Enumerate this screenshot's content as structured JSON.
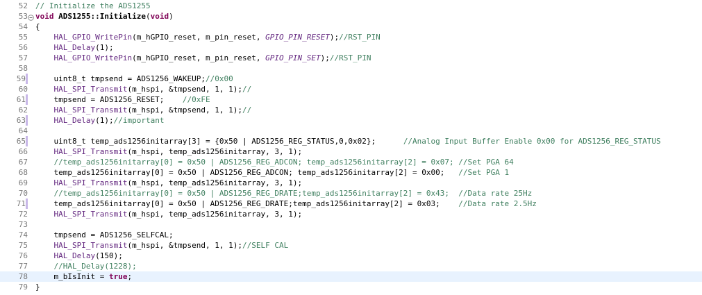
{
  "editor": {
    "lines": [
      {
        "num": "52",
        "tokens": [
          {
            "t": "// Initialize the ADS1255",
            "c": "cmt"
          }
        ]
      },
      {
        "num": "53",
        "fold": true,
        "tokens": [
          {
            "t": "void ",
            "c": "kw"
          },
          {
            "t": "ADS1255::Initialize",
            "c": "fn"
          },
          {
            "t": "(",
            "c": "plain"
          },
          {
            "t": "void",
            "c": "kw"
          },
          {
            "t": ")",
            "c": "plain"
          }
        ]
      },
      {
        "num": "54",
        "tokens": [
          {
            "t": "{",
            "c": "plain"
          }
        ]
      },
      {
        "num": "55",
        "tokens": [
          {
            "t": "    HAL_GPIO_WritePin",
            "c": "fnp"
          },
          {
            "t": "(m_hGPIO_reset, m_pin_reset, ",
            "c": "plain"
          },
          {
            "t": "GPIO_PIN_RESET",
            "c": "macro"
          },
          {
            "t": ");",
            "c": "plain"
          },
          {
            "t": "//RST_PIN",
            "c": "cmt"
          }
        ]
      },
      {
        "num": "56",
        "tokens": [
          {
            "t": "    HAL_Delay",
            "c": "fnp"
          },
          {
            "t": "(1);",
            "c": "plain"
          }
        ]
      },
      {
        "num": "57",
        "tokens": [
          {
            "t": "    HAL_GPIO_WritePin",
            "c": "fnp"
          },
          {
            "t": "(m_hGPIO_reset, m_pin_reset, ",
            "c": "plain"
          },
          {
            "t": "GPIO_PIN_SET",
            "c": "macro"
          },
          {
            "t": ");",
            "c": "plain"
          },
          {
            "t": "//RST_PIN",
            "c": "cmt"
          }
        ]
      },
      {
        "num": "58",
        "tokens": []
      },
      {
        "num": "59",
        "changed": true,
        "tokens": [
          {
            "t": "    uint8_t tmpsend = ADS1256_WAKEUP;",
            "c": "plain"
          },
          {
            "t": "//0x00",
            "c": "cmt"
          }
        ]
      },
      {
        "num": "60",
        "tokens": [
          {
            "t": "    HAL_SPI_Transmit",
            "c": "fnp"
          },
          {
            "t": "(m_hspi, &tmpsend, 1, 1);",
            "c": "plain"
          },
          {
            "t": "//",
            "c": "cmt"
          }
        ]
      },
      {
        "num": "61",
        "changed": true,
        "tokens": [
          {
            "t": "    tmpsend = ADS1256_RESET;    ",
            "c": "plain"
          },
          {
            "t": "//0xFE",
            "c": "cmt"
          }
        ]
      },
      {
        "num": "62",
        "tokens": [
          {
            "t": "    HAL_SPI_Transmit",
            "c": "fnp"
          },
          {
            "t": "(m_hspi, &tmpsend, 1, 1);",
            "c": "plain"
          },
          {
            "t": "//",
            "c": "cmt"
          }
        ]
      },
      {
        "num": "63",
        "changed": true,
        "tokens": [
          {
            "t": "    HAL_Delay",
            "c": "fnp"
          },
          {
            "t": "(1);",
            "c": "plain"
          },
          {
            "t": "//important",
            "c": "cmt"
          }
        ]
      },
      {
        "num": "64",
        "tokens": []
      },
      {
        "num": "65",
        "changed": true,
        "tokens": [
          {
            "t": "    uint8_t temp_ads1256initarray[3] = {0x50 | ADS1256_REG_STATUS,0,0x02};      ",
            "c": "plain"
          },
          {
            "t": "//Analog Input Buffer Enable 0x00 for ADS1256_REG_STATUS",
            "c": "cmt"
          }
        ]
      },
      {
        "num": "66",
        "tokens": [
          {
            "t": "    HAL_SPI_Transmit",
            "c": "fnp"
          },
          {
            "t": "(m_hspi, temp_ads1256initarray, 3, 1);",
            "c": "plain"
          }
        ]
      },
      {
        "num": "67",
        "tokens": [
          {
            "t": "    //temp_ads1256initarray[0] = 0x50 | ADS1256_REG_ADCON; temp_ads1256initarray[2] = 0x07; //Set PGA 64",
            "c": "cmt"
          }
        ]
      },
      {
        "num": "68",
        "tokens": [
          {
            "t": "    temp_ads1256initarray[0] = 0x50 | ADS1256_REG_ADCON; temp_ads1256initarray[2] = 0x00;   ",
            "c": "plain"
          },
          {
            "t": "//Set PGA 1",
            "c": "cmt"
          }
        ]
      },
      {
        "num": "69",
        "tokens": [
          {
            "t": "    HAL_SPI_Transmit",
            "c": "fnp"
          },
          {
            "t": "(m_hspi, temp_ads1256initarray, 3, 1);",
            "c": "plain"
          }
        ]
      },
      {
        "num": "70",
        "tokens": [
          {
            "t": "    //temp_ads1256initarray[0] = 0x50 | ADS1256_REG_DRATE;temp_ads1256initarray[2] = 0x43;  //Data rate 25Hz",
            "c": "cmt"
          }
        ]
      },
      {
        "num": "71",
        "changed": true,
        "tokens": [
          {
            "t": "    temp_ads1256initarray[0] = 0x50 | ADS1256_REG_DRATE;temp_ads1256initarray[2] = 0x03;    ",
            "c": "plain"
          },
          {
            "t": "//Data rate 2.5Hz",
            "c": "cmt"
          }
        ]
      },
      {
        "num": "72",
        "tokens": [
          {
            "t": "    HAL_SPI_Transmit",
            "c": "fnp"
          },
          {
            "t": "(m_hspi, temp_ads1256initarray, 3, 1);",
            "c": "plain"
          }
        ]
      },
      {
        "num": "73",
        "tokens": []
      },
      {
        "num": "74",
        "tokens": [
          {
            "t": "    tmpsend = ADS1256_SELFCAL;",
            "c": "plain"
          }
        ]
      },
      {
        "num": "75",
        "tokens": [
          {
            "t": "    HAL_SPI_Transmit",
            "c": "fnp"
          },
          {
            "t": "(m_hspi, &tmpsend, 1, 1);",
            "c": "plain"
          },
          {
            "t": "//SELF CAL",
            "c": "cmt"
          }
        ]
      },
      {
        "num": "76",
        "tokens": [
          {
            "t": "    HAL_Delay",
            "c": "fnp"
          },
          {
            "t": "(150);",
            "c": "plain"
          }
        ]
      },
      {
        "num": "77",
        "tokens": [
          {
            "t": "    //HAL_Delay(1228);",
            "c": "cmt"
          }
        ]
      },
      {
        "num": "78",
        "current": true,
        "tokens": [
          {
            "t": "    m_bIsInit = ",
            "c": "plain"
          },
          {
            "t": "true",
            "c": "kw"
          },
          {
            "t": ";",
            "c": "plain"
          }
        ]
      },
      {
        "num": "79",
        "tokens": [
          {
            "t": "}",
            "c": "plain"
          }
        ]
      }
    ]
  }
}
